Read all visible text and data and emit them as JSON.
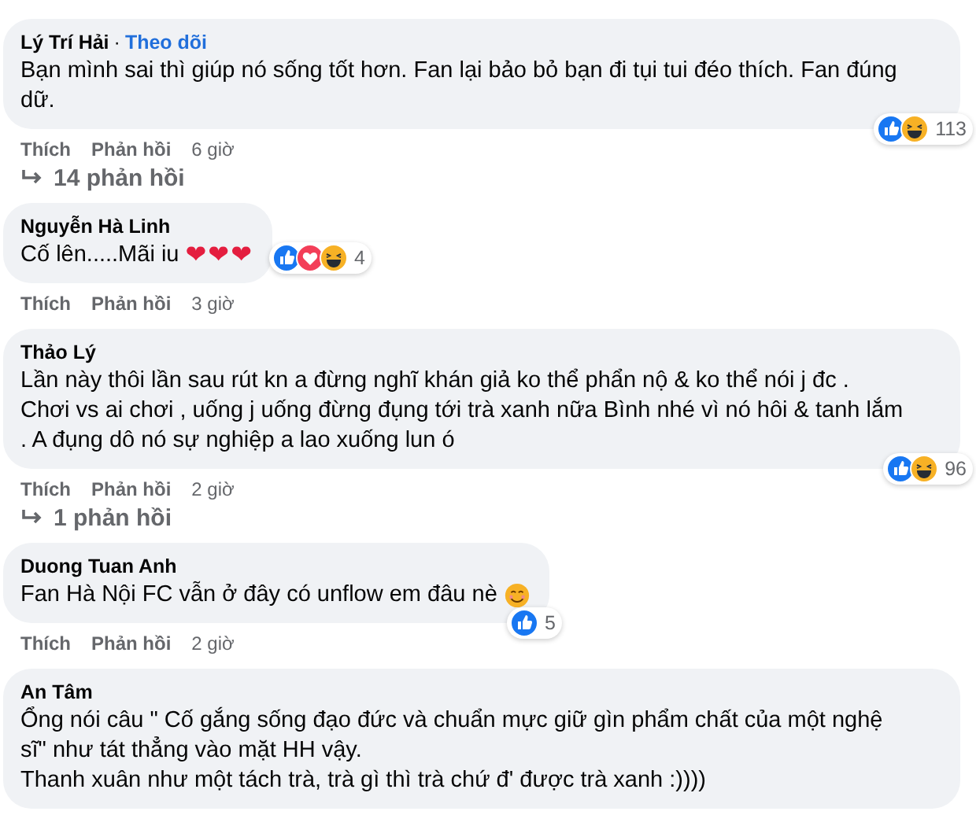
{
  "comments": [
    {
      "author": "Lý Trí Hải",
      "separator": "·",
      "follow_link": "Theo dõi",
      "lines": [
        "Bạn mình sai thì giúp nó sống tốt hơn. Fan lại bảo bỏ bạn đi tụi tui đéo thích. Fan đúng",
        "dữ."
      ],
      "reactions": [
        {
          "kind": "like"
        },
        {
          "kind": "haha"
        }
      ],
      "reaction_count": "113",
      "actions": [
        "Thích",
        "Phản hồi"
      ],
      "time": "6 giờ",
      "replies": "14 phản hồi"
    },
    {
      "author": "Nguyễn Hà Linh",
      "lines": [
        "Cố lên.....Mãi iu "
      ],
      "hearts": "❤❤❤",
      "reactions": [
        {
          "kind": "like"
        },
        {
          "kind": "love"
        },
        {
          "kind": "haha"
        }
      ],
      "reaction_count": "4",
      "actions": [
        "Thích",
        "Phản hồi"
      ],
      "time": "3 giờ"
    },
    {
      "author": "Thảo Lý",
      "lines": [
        "Lần này thôi lần sau rút kn a đừng nghĩ khán giả ko thể phẩn nộ & ko thể nói j đc .",
        "Chơi vs ai chơi , uống j uống đừng đụng tới trà xanh nữa Bình nhé vì nó hôi & tanh lắm",
        ". A đụng dô nó sự nghiệp a lao xuống lun ó"
      ],
      "reactions": [
        {
          "kind": "like"
        },
        {
          "kind": "haha"
        }
      ],
      "reaction_count": "96",
      "actions": [
        "Thích",
        "Phản hồi"
      ],
      "time": "2 giờ",
      "replies": "1 phản hồi"
    },
    {
      "author": "Duong Tuan Anh",
      "lines": [
        "Fan Hà Nội FC vẫn ở đây có unflow em đâu nè "
      ],
      "trailing_emoji": {
        "kind": "smile"
      },
      "reactions": [
        {
          "kind": "like"
        }
      ],
      "reaction_count": "5",
      "actions": [
        "Thích",
        "Phản hồi"
      ],
      "time": "2 giờ"
    },
    {
      "author": "An Tâm",
      "lines": [
        "Ổng nói câu \" Cố gắng sống đạo đức và chuẩn mực giữ gìn phẩm chất của một nghệ",
        "sĩ\" như tát thẳng vào mặt HH vậy.",
        "Thanh xuân như một tách trà, trà gì thì trà chứ đ' được trà xanh :))))"
      ]
    }
  ]
}
